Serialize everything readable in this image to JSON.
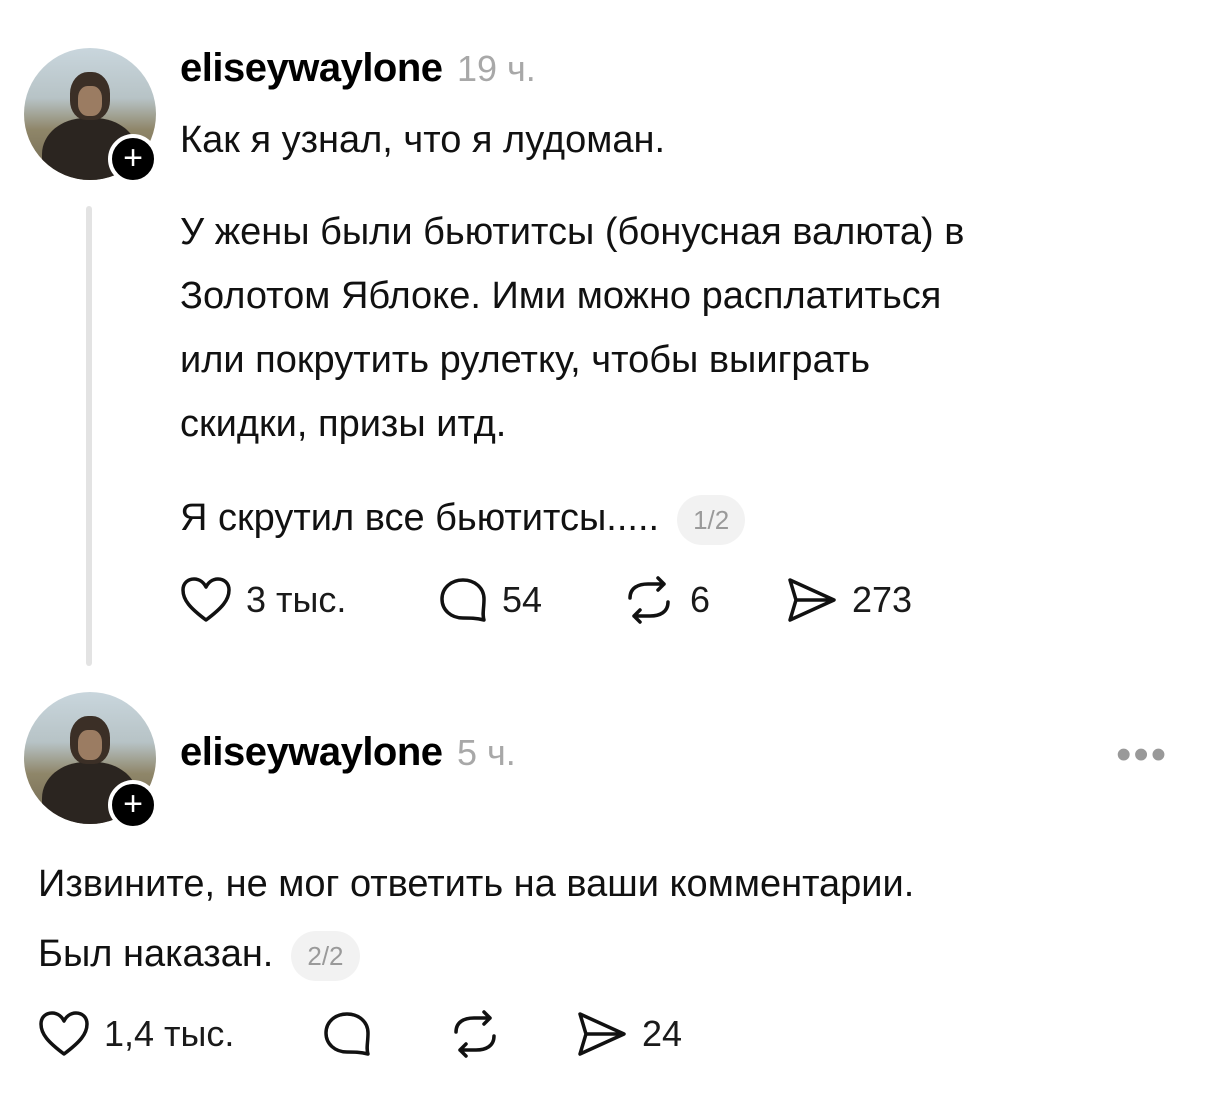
{
  "posts": [
    {
      "username": "eliseywaylone",
      "time": "19 ч.",
      "paragraphs": [
        "Как я узнал, что я лудоман.",
        "У жены были бьютитсы (бонусная валюта) в",
        "Золотом Яблоке. Ими можно расплатиться",
        "или покрутить рулетку, чтобы выиграть",
        "скидки, призы итд.",
        "Я скрутил все бьютитсы....."
      ],
      "counter": "1/2",
      "actions": {
        "likes": "3 тыс.",
        "comments": "54",
        "reposts": "6",
        "shares": "273"
      }
    },
    {
      "username": "eliseywaylone",
      "time": "5 ч.",
      "more": "•••",
      "paragraphs": [
        "Извините, не мог ответить на ваши комментарии.",
        "Был наказан."
      ],
      "counter": "2/2",
      "actions": {
        "likes": "1,4 тыс.",
        "shares": "24"
      }
    }
  ],
  "badge_plus": "+"
}
